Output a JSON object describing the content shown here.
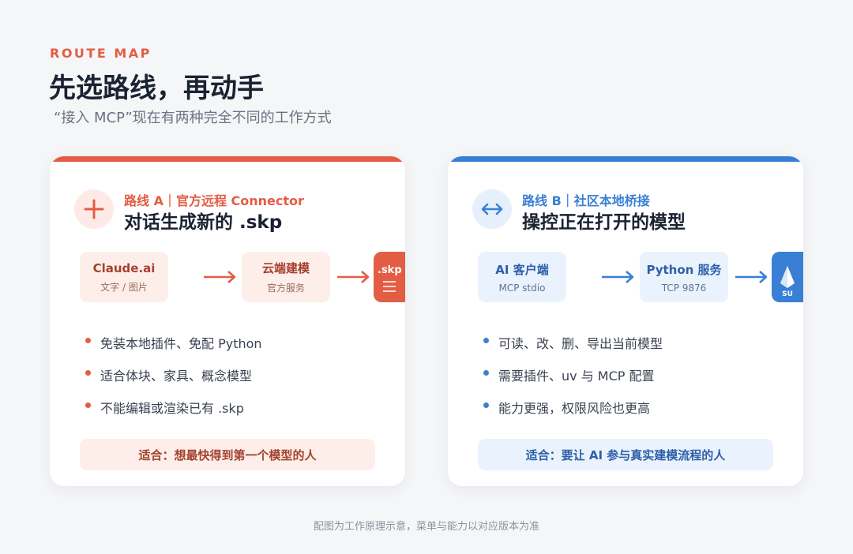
{
  "header": {
    "eyebrow": "ROUTE MAP",
    "title": "先选路线，再动手",
    "subtitle": "“接入 MCP”现在有两种完全不同的工作方式"
  },
  "colors": {
    "route_a": "#e35d44",
    "route_b": "#3a7fd6"
  },
  "routes": [
    {
      "icon": "plus-icon",
      "label": "路线 A｜官方远程 Connector",
      "title": "对话生成新的 .skp",
      "nodes": [
        {
          "title": "Claude.ai",
          "sub": "文字 / 图片"
        },
        {
          "title": "云端建模",
          "sub": "官方服务"
        }
      ],
      "endcap": {
        "icon": "skp-file-icon",
        "text": ".skp"
      },
      "bullets": [
        "免装本地插件、免配 Python",
        "适合体块、家具、概念模型",
        "不能编辑或渲染已有 .skp"
      ],
      "fit": "适合：想最快得到第一个模型的人"
    },
    {
      "icon": "bidirectional-arrow-icon",
      "label": "路线 B｜社区本地桥接",
      "title": "操控正在打开的模型",
      "nodes": [
        {
          "title": "AI 客户端",
          "sub": "MCP stdio"
        },
        {
          "title": "Python 服务",
          "sub": "TCP 9876"
        }
      ],
      "endcap": {
        "icon": "sketchup-logo-icon",
        "text": "SU"
      },
      "bullets": [
        "可读、改、删、导出当前模型",
        "需要插件、uv 与 MCP 配置",
        "能力更强，权限风险也更高"
      ],
      "fit": "适合：要让 AI 参与真实建模流程的人"
    }
  ],
  "footnote": "配图为工作原理示意，菜单与能力以对应版本为准"
}
